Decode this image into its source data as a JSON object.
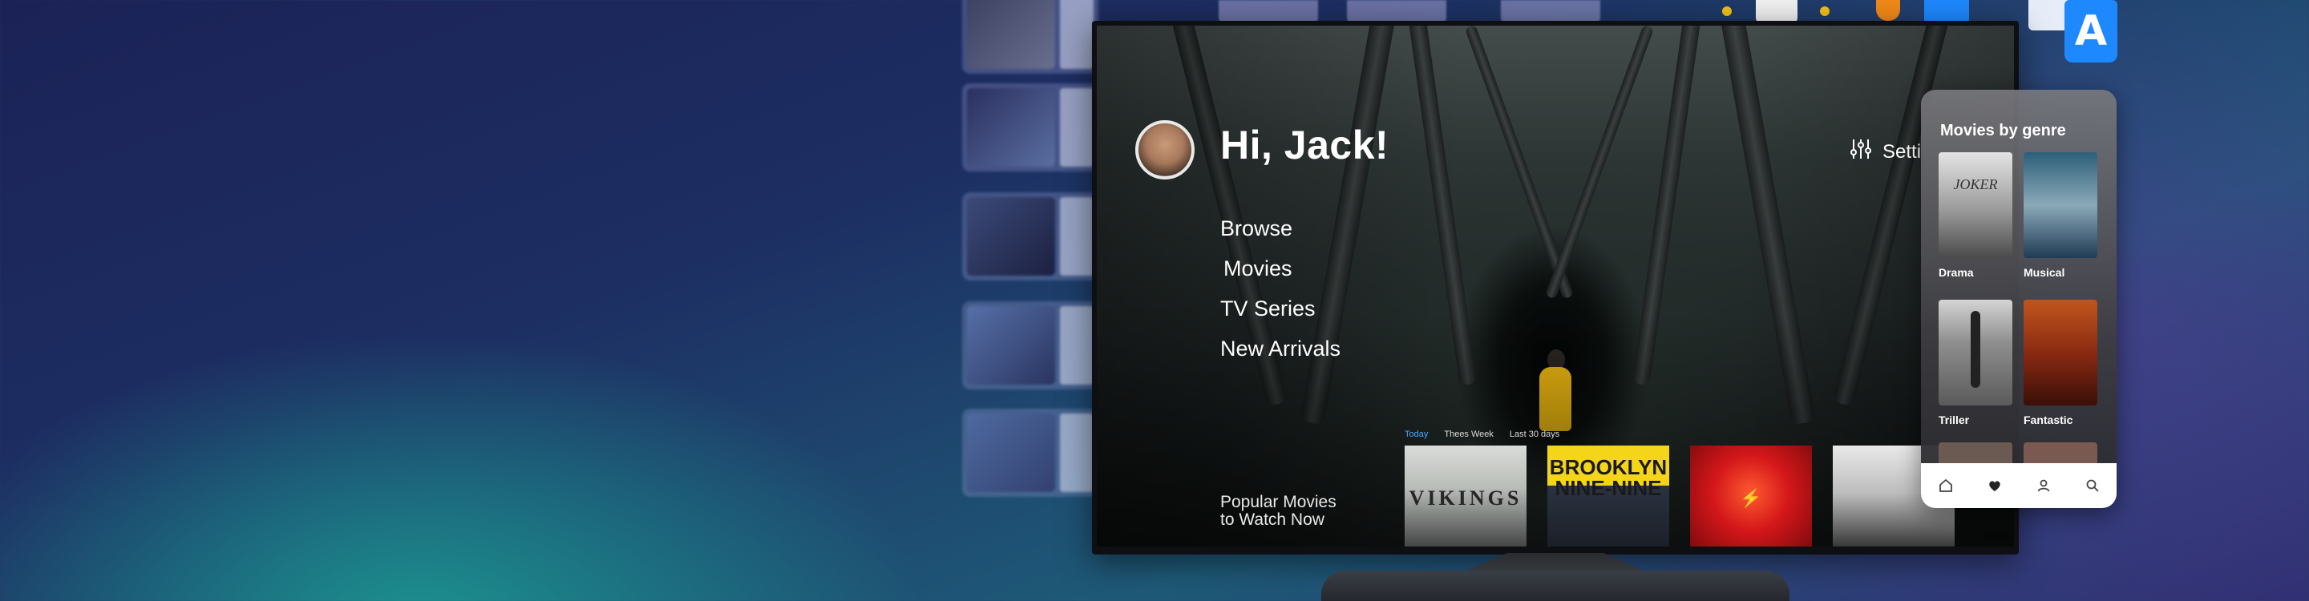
{
  "tv_app": {
    "greeting": "Hi, Jack!",
    "settings_label": "Setti",
    "nav_items": [
      "Browse",
      "Movies",
      "TV Series",
      "New Arrivals"
    ],
    "popular_line1": "Popular Movies",
    "popular_line2": "to Watch Now",
    "filters": [
      "Today",
      "Thees Week",
      "Last 30 days"
    ],
    "movies": [
      {
        "title_text": "VIKINGS"
      },
      {
        "title_text": "BROOKLYN NINE-NINE"
      },
      {
        "title_text": "⚡"
      },
      {
        "title_text": ""
      }
    ]
  },
  "phone_app": {
    "title": "Movies by genre",
    "genres": [
      "Drama",
      "Musical",
      "Triller",
      "Fantastic"
    ],
    "poster_texts": [
      "JOKER"
    ],
    "tabs": [
      "home-icon",
      "heart-icon",
      "profile-icon",
      "search-icon"
    ]
  },
  "top_icons": {
    "translate_letter": "A"
  },
  "colors": {
    "accent_blue": "#48a8ff",
    "figure_yellow": "#e8b410",
    "translate_blue": "#1e88ff"
  }
}
